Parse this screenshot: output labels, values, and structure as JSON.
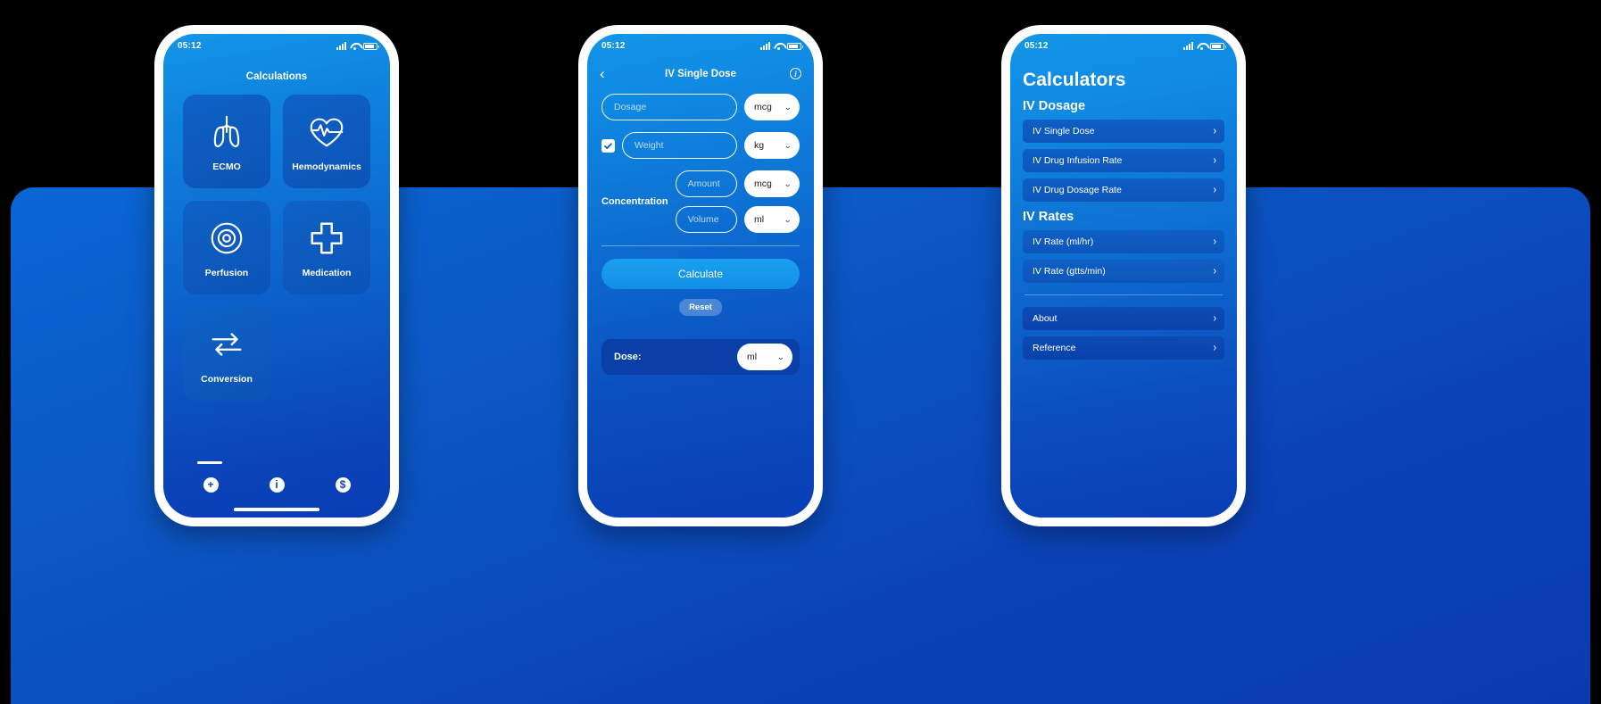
{
  "status_bar": {
    "time": "05:12",
    "icons": [
      "signal-icon",
      "wifi-icon",
      "battery-icon"
    ]
  },
  "phone1": {
    "title": "Calculations",
    "tiles": [
      {
        "label": "ECMO",
        "icon": "lungs-icon"
      },
      {
        "label": "Hemodynamics",
        "icon": "heart-pulse-icon"
      },
      {
        "label": "Perfusion",
        "icon": "perfusion-icon"
      },
      {
        "label": "Medication",
        "icon": "medical-cross-icon"
      },
      {
        "label": "Conversion",
        "icon": "exchange-arrows-icon"
      }
    ],
    "tabs": [
      {
        "name": "add-tab",
        "glyph": "+",
        "active": true
      },
      {
        "name": "info-tab",
        "glyph": "i",
        "active": false
      },
      {
        "name": "dollar-tab",
        "glyph": "$",
        "active": false
      }
    ]
  },
  "phone2": {
    "nav": {
      "back": "‹",
      "title": "IV Single Dose",
      "info": "i"
    },
    "fields": {
      "dosage": {
        "placeholder": "Dosage",
        "value": "",
        "unit": "mcg"
      },
      "weight": {
        "placeholder": "Weight",
        "value": "",
        "unit": "kg",
        "checked": true
      },
      "concentration_label": "Concentration",
      "amount": {
        "placeholder": "Amount",
        "value": "",
        "unit": "mcg"
      },
      "volume": {
        "placeholder": "Volume",
        "value": "",
        "unit": "ml"
      }
    },
    "calculate_label": "Calculate",
    "reset_label": "Reset",
    "result": {
      "label": "Dose:",
      "value": "",
      "unit": "ml"
    }
  },
  "phone3": {
    "title": "Calculators",
    "sections": [
      {
        "heading": "IV Dosage",
        "items": [
          "IV Single Dose",
          "IV Drug Infusion Rate",
          "IV Drug Dosage Rate"
        ]
      },
      {
        "heading": "IV Rates",
        "items": [
          "IV Rate (ml/hr)",
          "IV Rate (gtts/min)"
        ]
      }
    ],
    "footer_items": [
      "About",
      "Reference"
    ],
    "chevron": "›"
  },
  "colors": {
    "accent_light": "#1296e8",
    "accent_mid": "#0d6cd1",
    "accent_deep": "#0a3cb4",
    "tile": "#0f62c6",
    "calculate": "#1aa0f0",
    "result_bg": "#0b3fa8",
    "background": "#000000"
  }
}
